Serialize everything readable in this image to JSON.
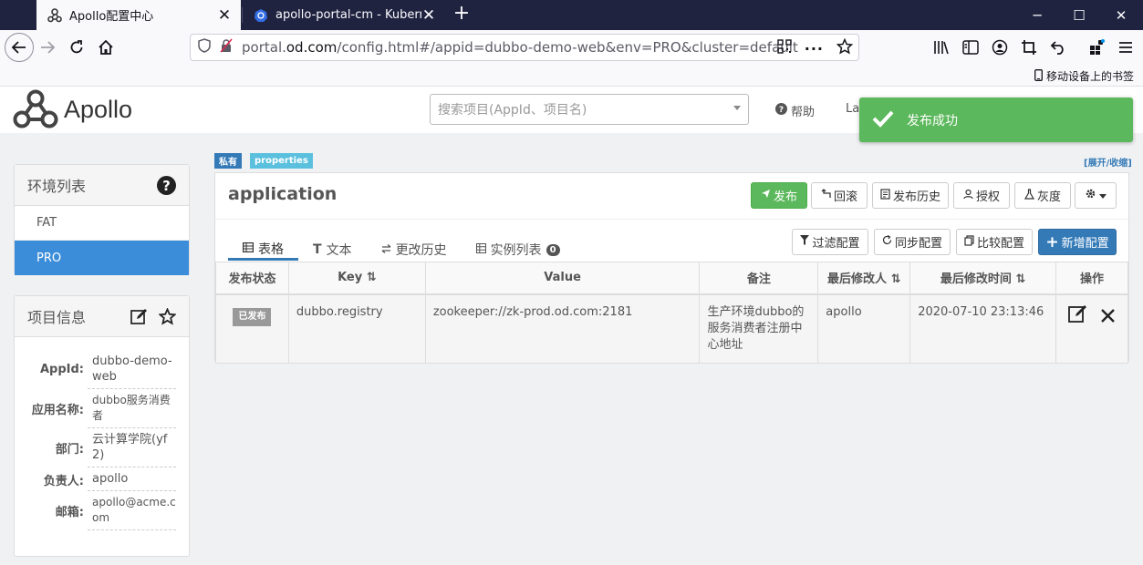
{
  "browser": {
    "tabs": [
      {
        "title": "Apollo配置中心",
        "active": true
      },
      {
        "title": "apollo-portal-cm - Kuberneti",
        "active": false
      }
    ],
    "url_prefix": "portal.",
    "url_host": "od.com",
    "url_path": "/config.html#/appid=dubbo-demo-web&env=PRO&cluster=default",
    "bookmark": "移动设备上的书签"
  },
  "header": {
    "logo": "Apollo",
    "search_placeholder": "搜索项目(AppId、项目名)",
    "help": "帮助",
    "lang": "La"
  },
  "toast": {
    "message": "发布成功",
    "color": "#5cb85c"
  },
  "env_panel": {
    "title": "环境列表",
    "items": [
      {
        "label": "FAT",
        "active": false
      },
      {
        "label": "PRO",
        "active": true
      }
    ]
  },
  "info_panel": {
    "title": "项目信息",
    "rows": [
      {
        "label": "AppId:",
        "value": "dubbo-demo-web"
      },
      {
        "label": "应用名称:",
        "value": "dubbo服务消费者"
      },
      {
        "label": "部门:",
        "value": "云计算学院(yf2)"
      },
      {
        "label": "负责人:",
        "value": "apollo"
      },
      {
        "label": "邮箱:",
        "value": "apollo@acme.com"
      }
    ]
  },
  "namespace": {
    "badge_private": "私有",
    "badge_format": "properties",
    "expand_link": "[展开/收缩]",
    "title": "application",
    "actions": {
      "publish": "发布",
      "rollback": "回滚",
      "history": "发布历史",
      "grant": "授权",
      "gray": "灰度"
    },
    "tabs": {
      "table": "表格",
      "text": "文本",
      "change_history": "更改历史",
      "instances": "实例列表",
      "instances_count": "0"
    },
    "tools": {
      "filter": "过滤配置",
      "sync": "同步配置",
      "compare": "比较配置",
      "add": "新增配置"
    },
    "columns": {
      "status": "发布状态",
      "key": "Key",
      "value": "Value",
      "comment": "备注",
      "modifier": "最后修改人",
      "modified_time": "最后修改时间",
      "ops": "操作"
    },
    "rows": [
      {
        "status": "已发布",
        "key": "dubbo.registry",
        "value": "zookeeper://zk-prod.od.com:2181",
        "comment": "生产环境dubbo的服务消费者注册中心地址",
        "modifier": "apollo",
        "modified_time": "2020-07-10 23:13:46"
      }
    ]
  }
}
